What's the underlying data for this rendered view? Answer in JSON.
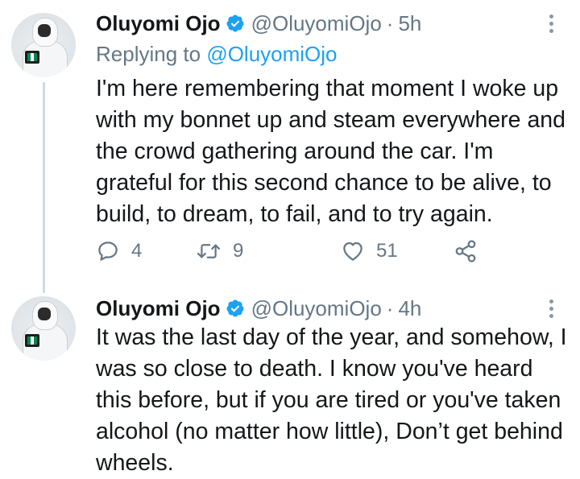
{
  "thread": {
    "tweets": [
      {
        "author_name": "Oluyomi Ojo",
        "handle": "@OluyomiOjo",
        "separator": "·",
        "time": "5h",
        "reply_prefix": "Replying to",
        "reply_mention": "@OluyomiOjo",
        "text": "I'm here remembering that moment I woke up with my bonnet up and steam everywhere and the crowd gathering around the car. I'm grateful for this second chance to be alive, to build, to dream, to fail, and to try again.",
        "reply_count": "4",
        "retweet_count": "9",
        "like_count": "51"
      },
      {
        "author_name": "Oluyomi Ojo",
        "handle": "@OluyomiOjo",
        "separator": "·",
        "time": "4h",
        "text": "It was the last day of the year, and somehow, I was so close to death. I know you've heard this before, but if you are tired or you've taken alcohol (no matter how little), Don’t get behind wheels."
      }
    ]
  },
  "colors": {
    "verified": "#1da1f2",
    "link": "#1da1f2",
    "secondary_text": "#657786",
    "thread_line": "#cfd9de"
  },
  "icons": {
    "verified": "verified-badge-icon",
    "more": "more-options-icon",
    "reply": "reply-icon",
    "retweet": "retweet-icon",
    "like": "heart-icon",
    "share": "share-icon"
  }
}
